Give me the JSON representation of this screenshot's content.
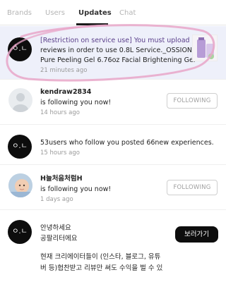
{
  "tabs": [
    {
      "label": "Brands"
    },
    {
      "label": "Users"
    },
    {
      "label": "Updates"
    },
    {
      "label": "Chat"
    }
  ],
  "notifications": [
    {
      "line1": "[Restriction on service use] You must upload",
      "line2": "reviews in order to use 0.8L Service._OSSION",
      "line3": "Pure Peeling Gel 6.76oz Facial Brightening Gel",
      "time": "21 minutes ago"
    },
    {
      "username": "kendraw2834",
      "text": "is following you now!",
      "time": "14 hours ago",
      "button": "FOLLOWING"
    },
    {
      "text": "53users who follow you posted 66new experiences.",
      "time": "15 hours ago"
    },
    {
      "username": "H늘처음처럼H",
      "text": "is following you now!",
      "time": "1 days ago",
      "button": "FOLLOWING"
    },
    {
      "line1": "안녕하세요",
      "line2": "공팔리터에요",
      "line3": "현재 크리에이터들이 (인스타, 블로그, 유튜",
      "line4": "버 등)협찬받고 리뷰만 써도 수익을 벌 수 있",
      "button": "보러가기"
    }
  ],
  "brand_logo_text": "ㅇ.ㄴ",
  "colors": {
    "highlight_bg": "#eef0fa",
    "scribble": "#e8a6c8",
    "button_dark": "#0d0d0d"
  },
  "icons": [
    "brand-logo-icon",
    "user-placeholder-icon",
    "product-thumbnail",
    "baby-avatar"
  ]
}
